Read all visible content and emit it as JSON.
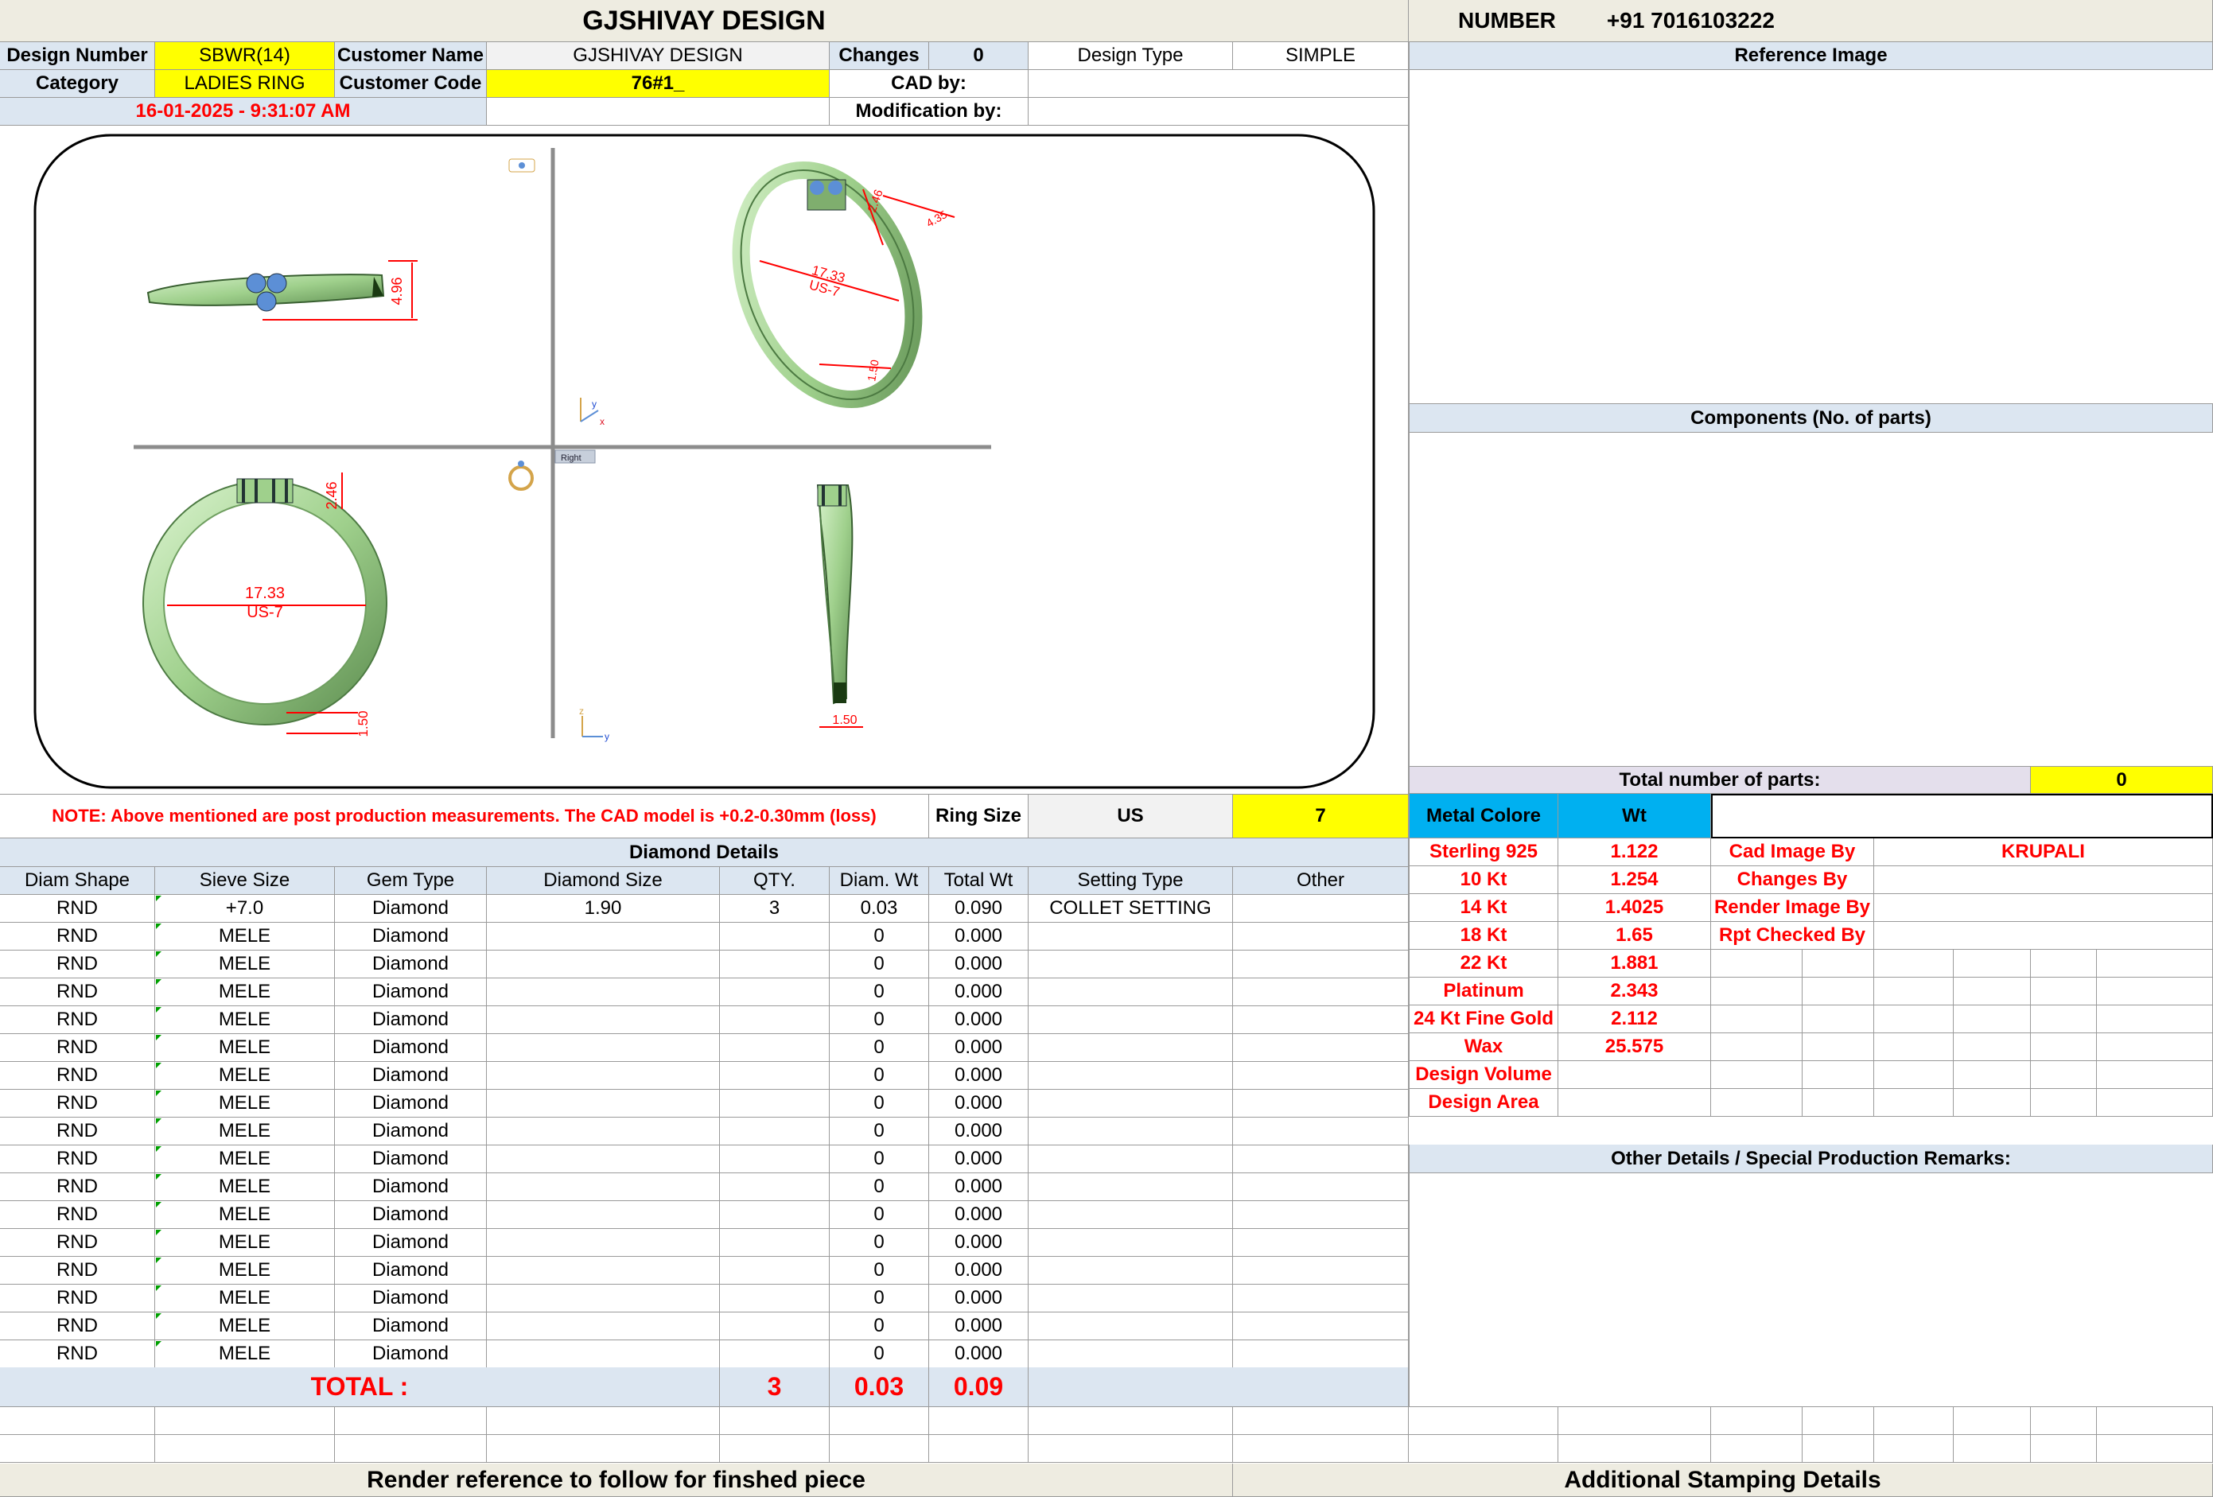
{
  "header": {
    "title": "GJSHIVAY DESIGN",
    "number_label": "NUMBER",
    "number_value": "+91 7016103222"
  },
  "info": {
    "design_number_label": "Design Number",
    "design_number": "SBWR(14)",
    "customer_name_label": "Customer Name",
    "customer_name": "GJSHIVAY DESIGN",
    "changes_label": "Changes",
    "changes": "0",
    "design_type_label": "Design Type",
    "design_type": "SIMPLE",
    "category_label": "Category",
    "category": "LADIES RING",
    "customer_code_label": "Customer Code",
    "customer_code": "76#1_",
    "cad_by_label": "CAD by:",
    "datetime": "16-01-2025 - 9:31:07 AM",
    "modification_by_label": "Modification by:"
  },
  "drawing": {
    "dim_top_height": "4.96",
    "dim_iso_diameter": "17.33",
    "dim_iso_size": "US-7",
    "dim_iso_1": "2.46",
    "dim_iso_2": "4.35",
    "dim_iso_3": "1.50",
    "dim_front_height": "2.46",
    "dim_front_diameter": "17.33",
    "dim_front_size": "US-7",
    "dim_front_bottom": "1.50",
    "dim_side_bottom": "1.50",
    "view_label": "Right",
    "axis_y": "y",
    "axis_x": "x",
    "axis_z": "z"
  },
  "note": {
    "text": "NOTE: Above mentioned are post production measurements. The CAD model is +0.2-0.30mm (loss)",
    "ring_size_label": "Ring Size",
    "ring_size_system": "US",
    "ring_size": "7"
  },
  "diamond": {
    "title": "Diamond Details",
    "columns": [
      "Diam Shape",
      "Sieve Size",
      "Gem Type",
      "Diamond Size",
      "QTY.",
      "Diam. Wt",
      "Total Wt",
      "Setting Type",
      "Other"
    ],
    "rows": [
      [
        "RND",
        "+7.0",
        "Diamond",
        "1.90",
        "3",
        "0.03",
        "0.090",
        "COLLET SETTING",
        ""
      ],
      [
        "RND",
        "MELE",
        "Diamond",
        "",
        "",
        "0",
        "0.000",
        "",
        ""
      ],
      [
        "RND",
        "MELE",
        "Diamond",
        "",
        "",
        "0",
        "0.000",
        "",
        ""
      ],
      [
        "RND",
        "MELE",
        "Diamond",
        "",
        "",
        "0",
        "0.000",
        "",
        ""
      ],
      [
        "RND",
        "MELE",
        "Diamond",
        "",
        "",
        "0",
        "0.000",
        "",
        ""
      ],
      [
        "RND",
        "MELE",
        "Diamond",
        "",
        "",
        "0",
        "0.000",
        "",
        ""
      ],
      [
        "RND",
        "MELE",
        "Diamond",
        "",
        "",
        "0",
        "0.000",
        "",
        ""
      ],
      [
        "RND",
        "MELE",
        "Diamond",
        "",
        "",
        "0",
        "0.000",
        "",
        ""
      ],
      [
        "RND",
        "MELE",
        "Diamond",
        "",
        "",
        "0",
        "0.000",
        "",
        ""
      ],
      [
        "RND",
        "MELE",
        "Diamond",
        "",
        "",
        "0",
        "0.000",
        "",
        ""
      ],
      [
        "RND",
        "MELE",
        "Diamond",
        "",
        "",
        "0",
        "0.000",
        "",
        ""
      ],
      [
        "RND",
        "MELE",
        "Diamond",
        "",
        "",
        "0",
        "0.000",
        "",
        ""
      ],
      [
        "RND",
        "MELE",
        "Diamond",
        "",
        "",
        "0",
        "0.000",
        "",
        ""
      ],
      [
        "RND",
        "MELE",
        "Diamond",
        "",
        "",
        "0",
        "0.000",
        "",
        ""
      ],
      [
        "RND",
        "MELE",
        "Diamond",
        "",
        "",
        "0",
        "0.000",
        "",
        ""
      ],
      [
        "RND",
        "MELE",
        "Diamond",
        "",
        "",
        "0",
        "0.000",
        "",
        ""
      ],
      [
        "RND",
        "MELE",
        "Diamond",
        "",
        "",
        "0",
        "0.000",
        "",
        ""
      ]
    ],
    "total_label": "TOTAL :",
    "total_qty": "3",
    "total_diam_wt": "0.03",
    "total_wt": "0.09"
  },
  "right": {
    "reference_image_label": "Reference Image",
    "components_label": "Components (No. of parts)",
    "total_parts_label": "Total number of parts:",
    "total_parts": "0",
    "metal_colore_label": "Metal Colore",
    "wt_label": "Wt",
    "metals": [
      {
        "name": "Sterling 925",
        "wt": "1.122"
      },
      {
        "name": "10 Kt",
        "wt": "1.254"
      },
      {
        "name": "14 Kt",
        "wt": "1.4025"
      },
      {
        "name": "18 Kt",
        "wt": "1.65"
      },
      {
        "name": "22 Kt",
        "wt": "1.881"
      },
      {
        "name": "Platinum",
        "wt": "2.343"
      },
      {
        "name": "24 Kt Fine Gold",
        "wt": "2.112"
      },
      {
        "name": "Wax",
        "wt": "25.575"
      },
      {
        "name": "Design Volume",
        "wt": ""
      },
      {
        "name": "Design Area",
        "wt": ""
      }
    ],
    "credits": [
      {
        "label": "Cad Image By",
        "value": "KRUPALI"
      },
      {
        "label": "Changes By",
        "value": ""
      },
      {
        "label": "Render Image By",
        "value": ""
      },
      {
        "label": "Rpt Checked By",
        "value": ""
      }
    ],
    "other_details_label": "Other Details / Special Production Remarks:"
  },
  "footer": {
    "render_reference": "Render reference to follow for finshed piece",
    "stamping": "Additional Stamping Details"
  },
  "colors": {
    "yellow": "#ffff00",
    "header_beige": "#eeece1",
    "light_blue": "#dce6f1",
    "red_text": "#ff0000",
    "metal_cyan": "#00b0f0",
    "ring_green": "#b7e4a8"
  }
}
